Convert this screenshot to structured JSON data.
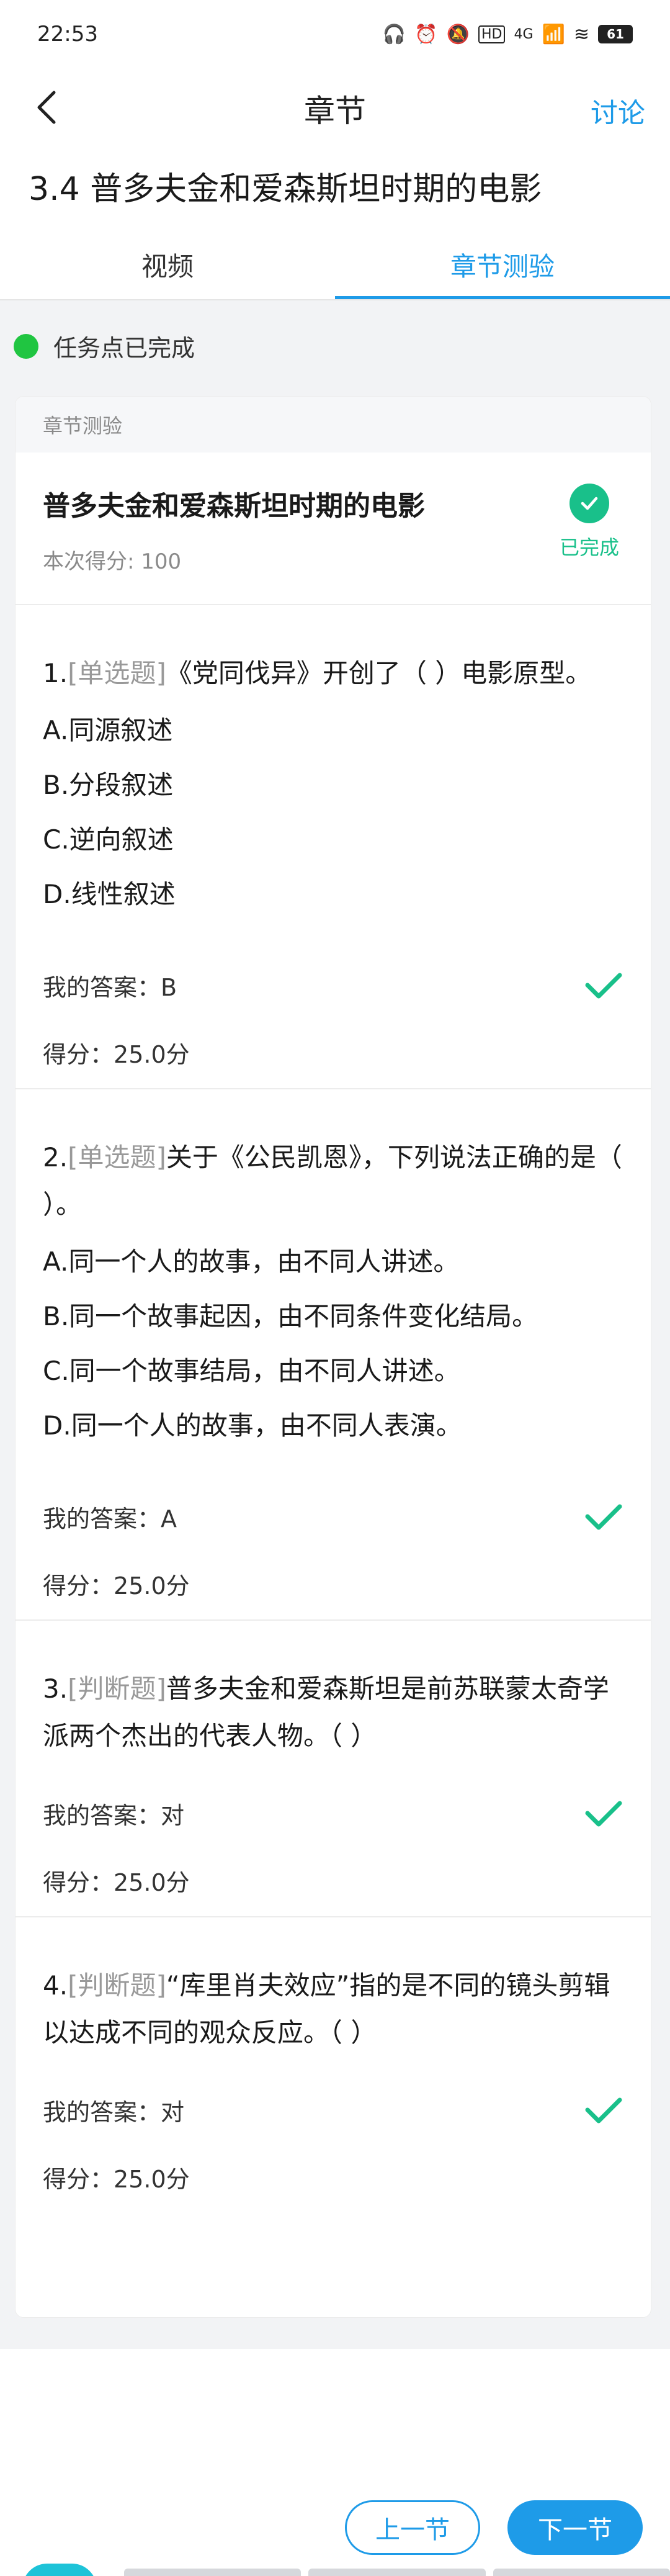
{
  "status_bar": {
    "time": "22:53",
    "network": "4G",
    "battery": "61"
  },
  "nav": {
    "title": "章节",
    "discuss_label": "讨论"
  },
  "chapter_title": "3.4 普多夫金和爱森斯坦时期的电影",
  "tabs": [
    {
      "label": "视频",
      "active": false
    },
    {
      "label": "章节测验",
      "active": true
    }
  ],
  "task_status": "任务点已完成",
  "quiz": {
    "header": "章节测验",
    "name": "普多夫金和爱森斯坦时期的电影",
    "score": "本次得分: 100",
    "status": "已完成"
  },
  "answer_label": "我的答案：",
  "points_label": "得分：",
  "questions": [
    {
      "number": "1.",
      "type": "[单选题]",
      "stem": "《党同伐异》开创了（ ）电影原型。",
      "options": [
        "A.同源叙述",
        "B.分段叙述",
        "C.逆向叙述",
        "D.线性叙述"
      ],
      "answer": "B",
      "points": "25.0分"
    },
    {
      "number": "2.",
      "type": "[单选题]",
      "stem": "关于《公民凯恩》，下列说法正确的是（ ）。",
      "options": [
        "A.同一个人的故事，由不同人讲述。",
        "B.同一个故事起因，由不同条件变化结局。",
        "C.同一个故事结局，由不同人讲述。",
        "D.同一个人的故事，由不同人表演。"
      ],
      "answer": "A",
      "points": "25.0分"
    },
    {
      "number": "3.",
      "type": "[判断题]",
      "stem": "普多夫金和爱森斯坦是前苏联蒙太奇学派两个杰出的代表人物。（ ）",
      "options": [],
      "answer": "对",
      "points": "25.0分"
    },
    {
      "number": "4.",
      "type": "[判断题]",
      "stem": "“库里肖夫效应”指的是不同的镜头剪辑以达成不同的观众反应。（ ）",
      "options": [],
      "answer": "对",
      "points": "25.0分"
    }
  ],
  "buttons": {
    "prev": "上一节",
    "next": "下一节"
  },
  "colors": {
    "accent": "#1e9be8",
    "success": "#19c08a",
    "task_dot": "#20c541"
  }
}
